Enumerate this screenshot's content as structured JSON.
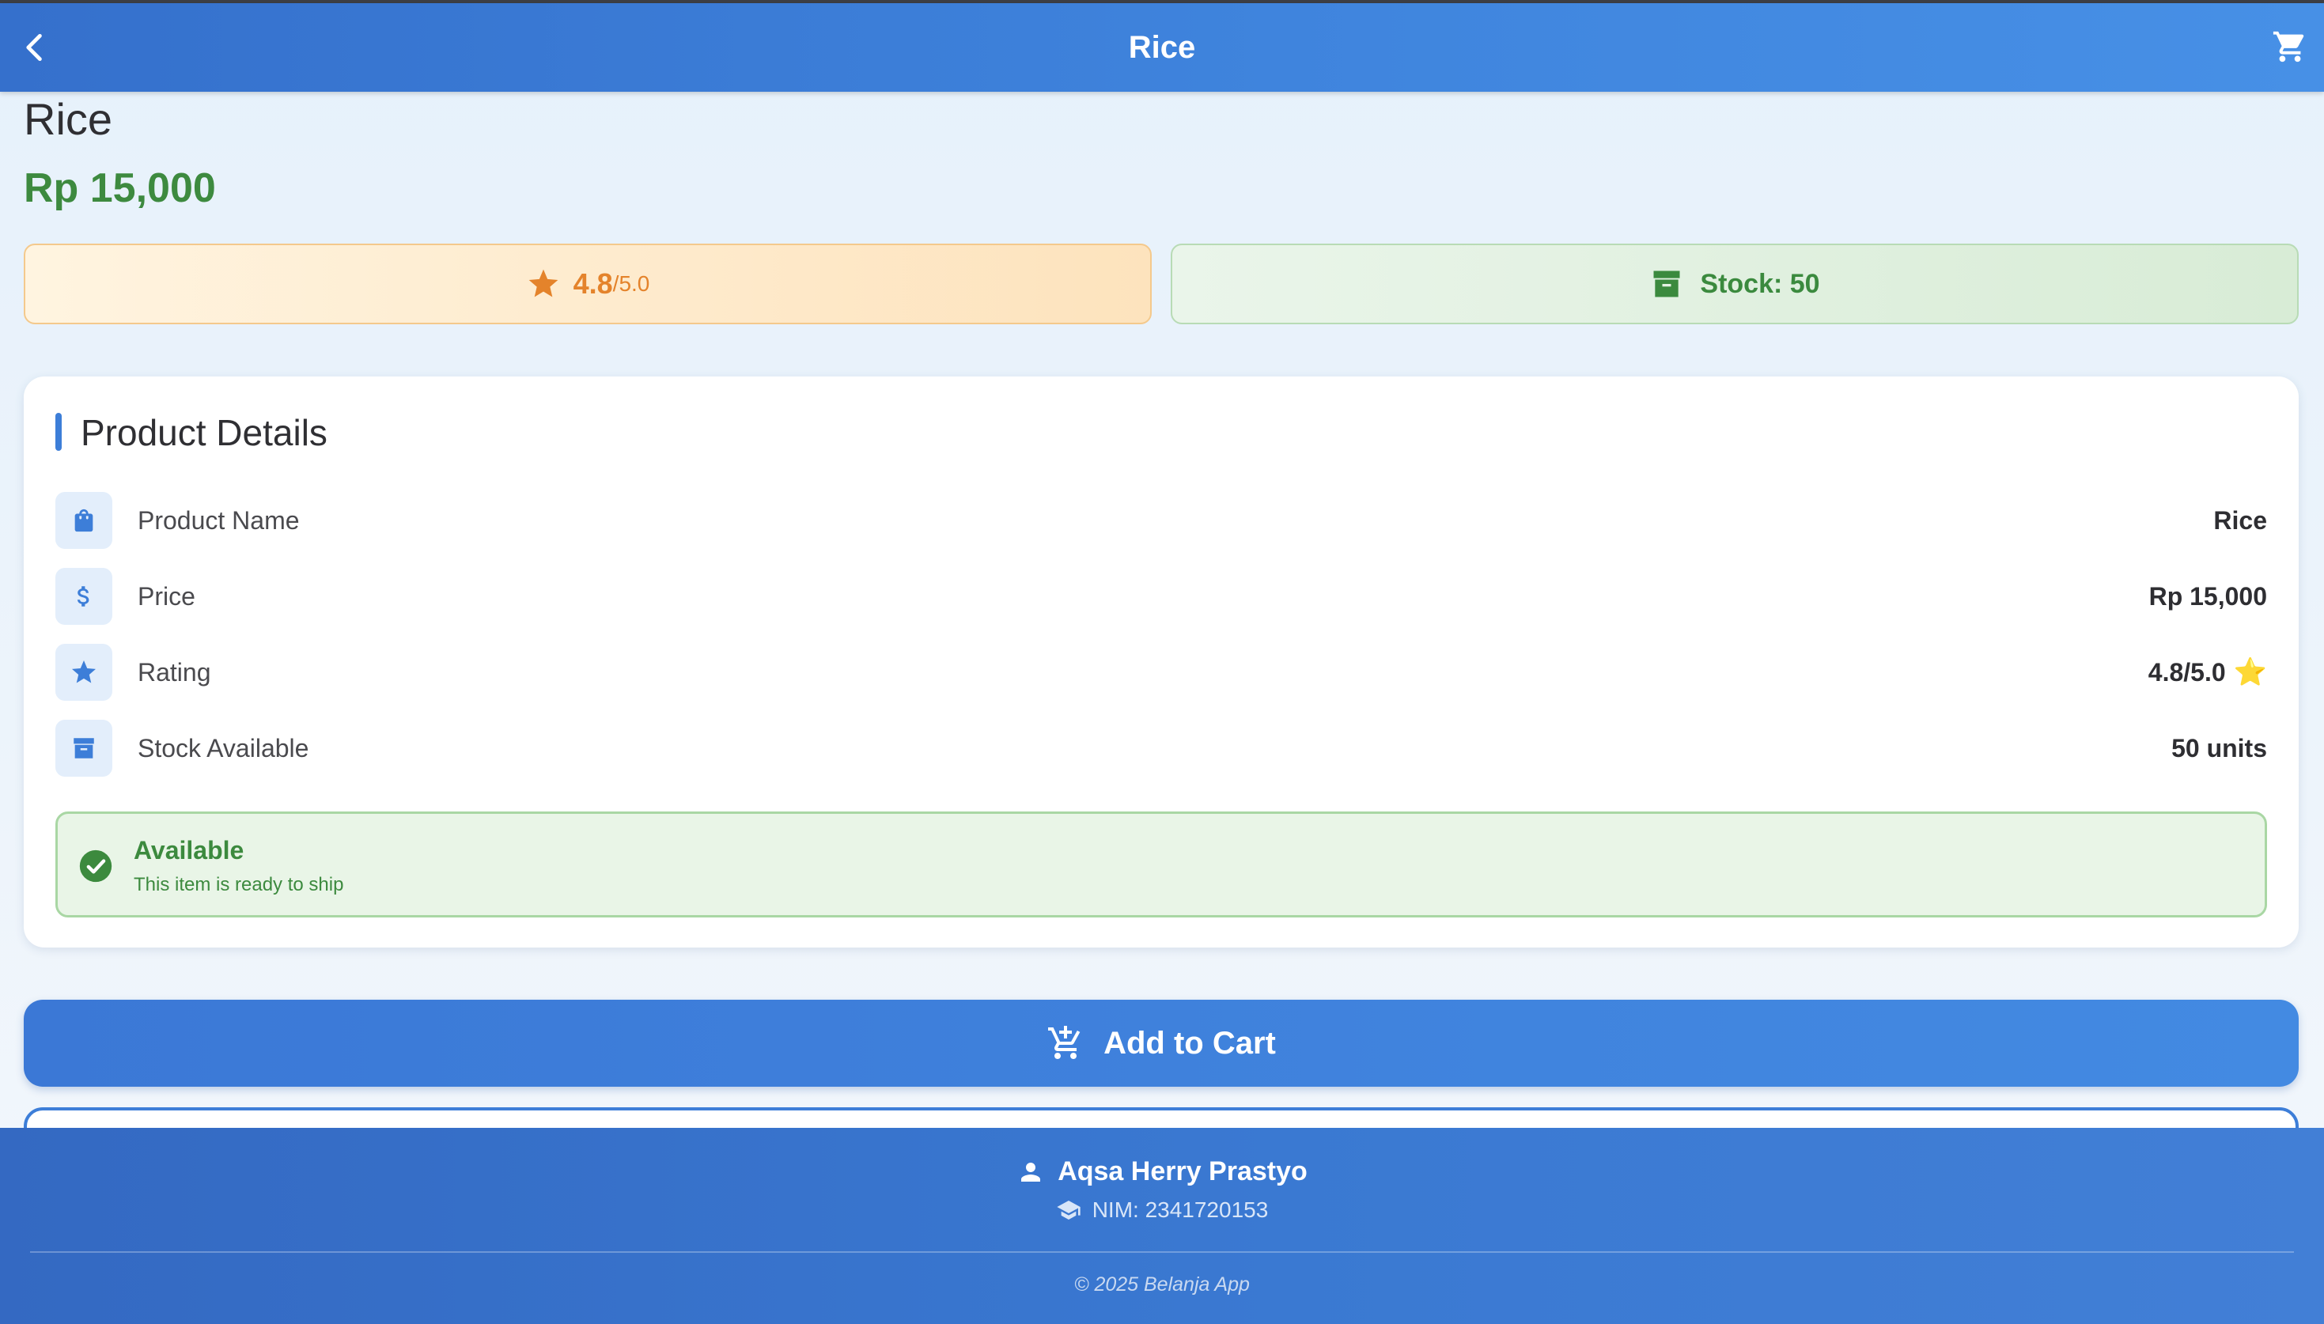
{
  "appbar": {
    "title": "Rice",
    "back_icon": "chevron-left-icon",
    "cart_icon": "shopping-cart-icon"
  },
  "product": {
    "name": "Rice",
    "price": "Rp 15,000"
  },
  "rating_pill": {
    "value": "4.8",
    "max": "/5.0",
    "icon": "star-icon"
  },
  "stock_pill": {
    "text": "Stock: 50",
    "icon": "archive-box-icon"
  },
  "details": {
    "section_title": "Product Details",
    "rows": [
      {
        "icon": "shopping-bag-icon",
        "label": "Product Name",
        "value": "Rice"
      },
      {
        "icon": "dollar-icon",
        "label": "Price",
        "value": "Rp 15,000"
      },
      {
        "icon": "star-icon",
        "label": "Rating",
        "value": "4.8/5.0",
        "emoji": "⭐"
      },
      {
        "icon": "archive-box-icon",
        "label": "Stock Available",
        "value": "50 units"
      }
    ]
  },
  "availability": {
    "title": "Available",
    "subtitle": "This item is ready to ship",
    "icon": "check-circle-icon"
  },
  "actions": {
    "add_to_cart": "Add to Cart",
    "add_to_cart_icon": "add-shopping-cart-icon"
  },
  "footer": {
    "name": "Aqsa Herry Prastyo",
    "nim": "NIM: 2341720153",
    "copyright": "© 2025 Belanja App"
  },
  "colors": {
    "primary": "#3d7ed8",
    "price_green": "#3d8a3f",
    "rating_orange": "#e4832b",
    "stock_green": "#3b8a3e"
  }
}
